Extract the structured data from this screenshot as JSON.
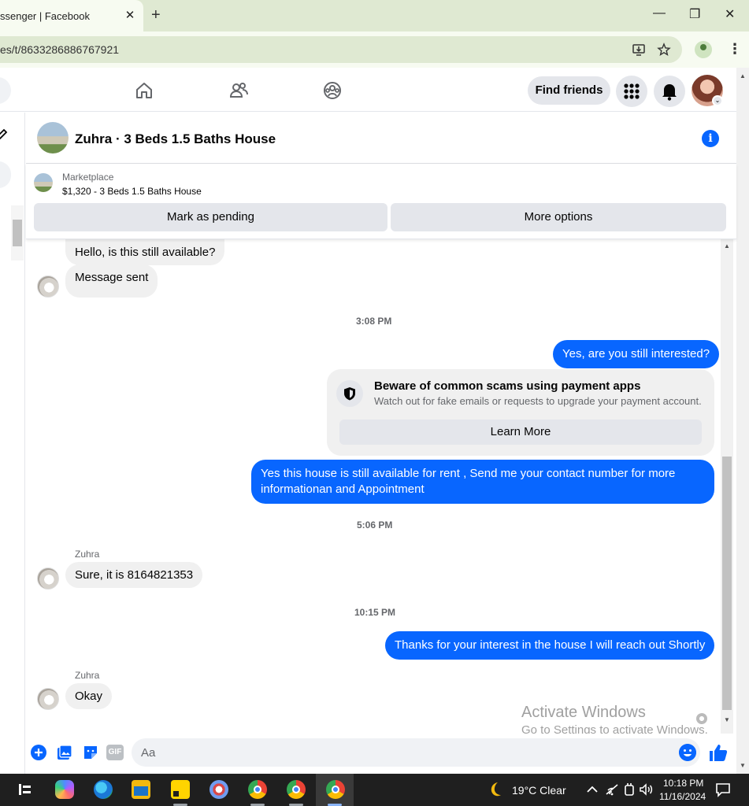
{
  "browser": {
    "tab_title": "ssenger | Facebook",
    "tab_close": "✕",
    "new_tab": "+",
    "minimize": "—",
    "restore": "❐",
    "close": "✕",
    "url": "es/t/8633286886767921",
    "menu_dots": "⋮"
  },
  "header": {
    "find_friends": "Find friends"
  },
  "chat": {
    "title": "Zuhra · 3 Beds 1.5 Baths House",
    "info": "i"
  },
  "marketplace": {
    "label": "Marketplace",
    "item": "$1,320 - 3 Beds 1.5 Baths House",
    "mark_pending": "Mark as pending",
    "more_options": "More options"
  },
  "messages": {
    "in_1": "Hello, is this still available?",
    "in_2": "Message sent",
    "ts_1": "3:08 PM",
    "out_1": "Yes, are you still interested?",
    "scam_title": "Beware of common scams using payment apps",
    "scam_sub": "Watch out for fake emails or requests to upgrade your payment account.",
    "learn_more": "Learn More",
    "out_2": "Yes this house is still available for rent , Send me your contact number for more informationan and Appointment",
    "ts_2": "5:06 PM",
    "sender_1": "Zuhra",
    "in_3": "Sure, it is 8164821353",
    "ts_3": "10:15 PM",
    "out_3": "Thanks for your interest in the house I will reach out Shortly",
    "sender_2": "Zuhra",
    "in_4": "Okay"
  },
  "watermark": {
    "line1": "Activate Windows",
    "line2": "Go to Settings to activate Windows."
  },
  "composer": {
    "placeholder": "Aa",
    "gif": "GIF"
  },
  "taskbar": {
    "weather": "19°C  Clear",
    "time": "10:18 PM",
    "date": "11/16/2024"
  },
  "colors": {
    "accent": "#0866ff",
    "bubble_in": "#f0f0f0",
    "taskbar": "#1f1f1f"
  }
}
